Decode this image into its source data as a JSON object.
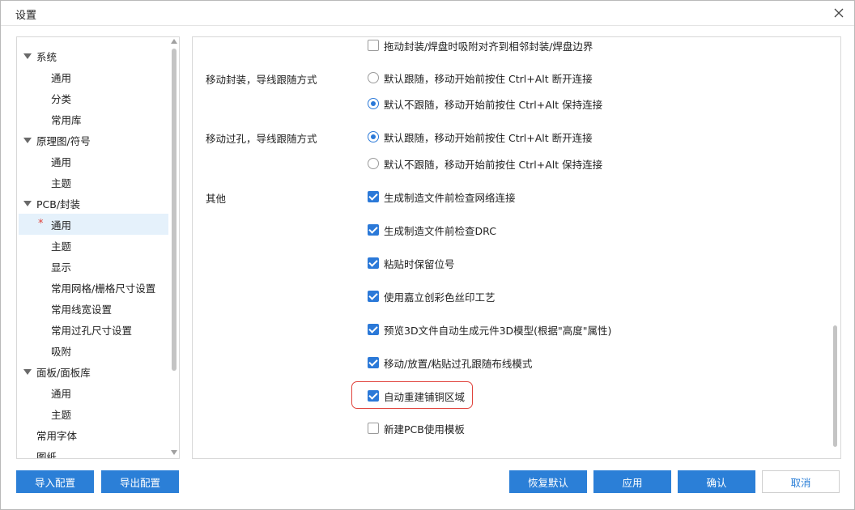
{
  "window": {
    "title": "设置"
  },
  "tree": {
    "items": [
      {
        "label": "系统",
        "level": 0,
        "expanded": true
      },
      {
        "label": "通用",
        "level": 1
      },
      {
        "label": "分类",
        "level": 1
      },
      {
        "label": "常用库",
        "level": 1
      },
      {
        "label": "原理图/符号",
        "level": 0,
        "expanded": true
      },
      {
        "label": "通用",
        "level": 1
      },
      {
        "label": "主题",
        "level": 1
      },
      {
        "label": "PCB/封装",
        "level": 0,
        "expanded": true
      },
      {
        "label": "通用",
        "level": 1,
        "selected": true,
        "marker": "*"
      },
      {
        "label": "主题",
        "level": 1
      },
      {
        "label": "显示",
        "level": 1
      },
      {
        "label": "常用网格/栅格尺寸设置",
        "level": 1
      },
      {
        "label": "常用线宽设置",
        "level": 1
      },
      {
        "label": "常用过孔尺寸设置",
        "level": 1
      },
      {
        "label": "吸附",
        "level": 1
      },
      {
        "label": "面板/面板库",
        "level": 0,
        "expanded": true
      },
      {
        "label": "通用",
        "level": 1
      },
      {
        "label": "主题",
        "level": 1
      },
      {
        "label": "常用字体",
        "level": 0
      },
      {
        "label": "图纸",
        "level": 0
      }
    ]
  },
  "settings": {
    "top_option": {
      "label": "拖动封装/焊盘时吸附对齐到相邻封装/焊盘边界",
      "checked": false
    },
    "move_footprint": {
      "label": "移动封装，导线跟随方式",
      "options": [
        {
          "label": "默认跟随，移动开始前按住 Ctrl+Alt 断开连接",
          "checked": false
        },
        {
          "label": "默认不跟随，移动开始前按住 Ctrl+Alt 保持连接",
          "checked": true
        }
      ]
    },
    "move_via": {
      "label": "移动过孔，导线跟随方式",
      "options": [
        {
          "label": "默认跟随，移动开始前按住 Ctrl+Alt 断开连接",
          "checked": true
        },
        {
          "label": "默认不跟随，移动开始前按住 Ctrl+Alt 保持连接",
          "checked": false
        }
      ]
    },
    "other": {
      "label": "其他",
      "options": [
        {
          "label": "生成制造文件前检查网络连接",
          "checked": true
        },
        {
          "label": "生成制造文件前检查DRC",
          "checked": true
        },
        {
          "label": "粘贴时保留位号",
          "checked": true
        },
        {
          "label": "使用嘉立创彩色丝印工艺",
          "checked": true
        },
        {
          "label": "预览3D文件自动生成元件3D模型(根据\"高度\"属性)",
          "checked": true
        },
        {
          "label": "移动/放置/粘贴过孔跟随布线模式",
          "checked": true
        },
        {
          "label": "自动重建铺铜区域",
          "checked": true,
          "highlighted": true
        },
        {
          "label": "新建PCB使用模板",
          "checked": false
        }
      ]
    }
  },
  "buttons": {
    "import": "导入配置",
    "export": "导出配置",
    "restore": "恢复默认",
    "apply": "应用",
    "confirm": "确认",
    "cancel": "取消"
  },
  "colors": {
    "accent": "#2b7fd7",
    "highlight": "#e0433c",
    "selected_row": "#e5f1fb"
  }
}
